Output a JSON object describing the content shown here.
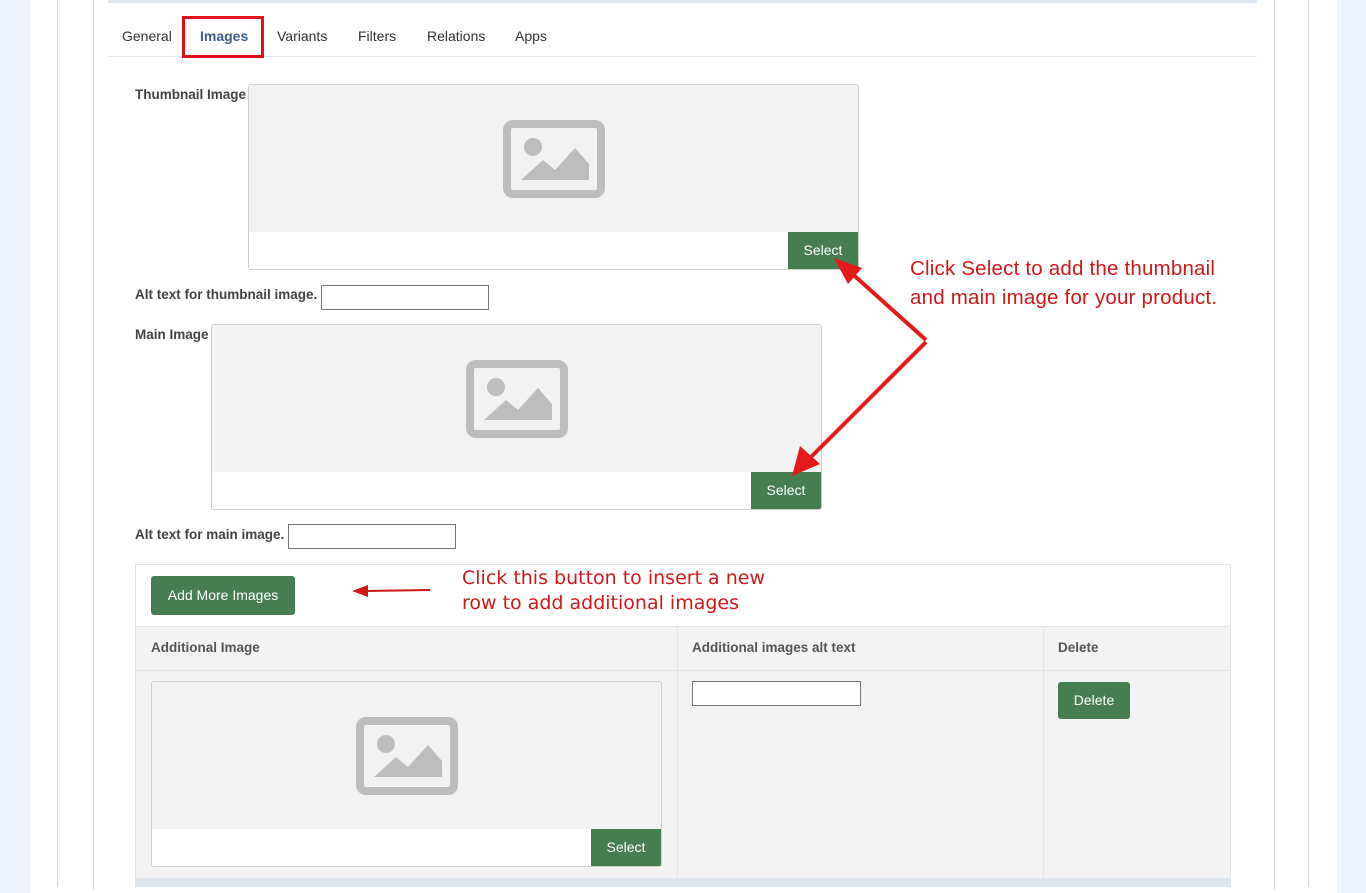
{
  "tabs": [
    {
      "label": "General"
    },
    {
      "label": "Images"
    },
    {
      "label": "Variants"
    },
    {
      "label": "Filters"
    },
    {
      "label": "Relations"
    },
    {
      "label": "Apps"
    }
  ],
  "active_tab": "Images",
  "thumbnail": {
    "label": "Thumbnail Image",
    "select_label": "Select",
    "alt_label": "Alt text for thumbnail image.",
    "alt_value": ""
  },
  "main_image": {
    "label": "Main Image",
    "select_label": "Select",
    "alt_label": "Alt text for main image.",
    "alt_value": ""
  },
  "additional": {
    "add_button_label": "Add More Images",
    "columns": [
      "Additional Image",
      "Additional images alt text",
      "Delete"
    ],
    "row": {
      "select_label": "Select",
      "alt_value": "",
      "delete_label": "Delete"
    }
  },
  "annotations": {
    "select_note_line1": "Click Select to add the thumbnail",
    "select_note_line2": "and main image for your product.",
    "add_note_line1": "Click this button to insert a new",
    "add_note_line2": "row to add additional images"
  },
  "colors": {
    "accent_green": "#467d51",
    "annotation_red": "#d01818",
    "tab_active": "#3e5c8a"
  },
  "icons": {
    "image_placeholder": "image-placeholder-icon"
  }
}
